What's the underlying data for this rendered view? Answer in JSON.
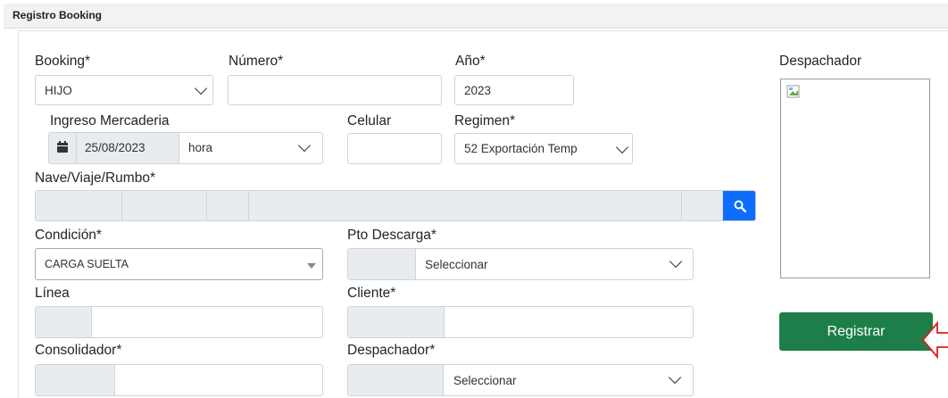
{
  "header": {
    "title": "Registro Booking"
  },
  "form": {
    "booking": {
      "label": "Booking*",
      "value": "HIJO"
    },
    "numero": {
      "label": "Número*",
      "value": ""
    },
    "anio": {
      "label": "Año*",
      "value": "2023"
    },
    "ingreso": {
      "label": "Ingreso Mercaderia",
      "date": "25/08/2023",
      "time": "hora"
    },
    "celular": {
      "label": "Celular",
      "value": ""
    },
    "regimen": {
      "label": "Regimen*",
      "value": "52 Exportación Temp"
    },
    "nave": {
      "label": "Nave/Viaje/Rumbo*"
    },
    "condicion": {
      "label": "Condición*",
      "value": "CARGA SUELTA"
    },
    "pto_descarga": {
      "label": "Pto Descarga*",
      "value": "Seleccionar"
    },
    "linea": {
      "label": "Línea"
    },
    "cliente": {
      "label": "Cliente*"
    },
    "consolidador": {
      "label": "Consolidador*"
    },
    "despachador_field": {
      "label": "Despachador*",
      "value": "Seleccionar"
    }
  },
  "side": {
    "despachador_title": "Despachador",
    "register_button": "Registrar"
  },
  "icons": {
    "calendar": "calendar-icon",
    "search": "search-icon",
    "arrow": "red-arrow-icon"
  },
  "colors": {
    "primary": "#0d6efd",
    "success": "#1e7e4a",
    "annotation": "#e11d1d"
  }
}
